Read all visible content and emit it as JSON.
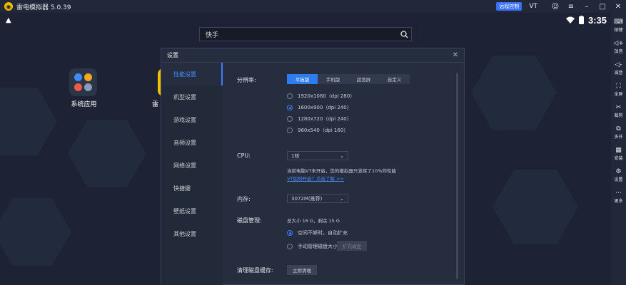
{
  "titlebar": {
    "title": "雷电模拟器 5.0.39",
    "badge": "远程控制",
    "vt": "VT"
  },
  "statusbar": {
    "time": "3:35"
  },
  "desktop": {
    "search_value": "快手",
    "apps": [
      {
        "label": "系统应用"
      },
      {
        "label": "雷"
      }
    ]
  },
  "sidebar": {
    "items": [
      {
        "icon": "keyboard-icon",
        "label": "按键"
      },
      {
        "icon": "volume-up-icon",
        "label": "加音"
      },
      {
        "icon": "volume-down-icon",
        "label": "减音"
      },
      {
        "icon": "fullscreen-icon",
        "label": "全屏"
      },
      {
        "icon": "scissors-icon",
        "label": "裁剪"
      },
      {
        "icon": "multi-window-icon",
        "label": "多开"
      },
      {
        "icon": "install-icon",
        "label": "安装"
      },
      {
        "icon": "gear-icon",
        "label": "设置"
      },
      {
        "icon": "more-icon",
        "label": "更多"
      }
    ]
  },
  "dialog": {
    "title": "设置",
    "nav": [
      "性能设置",
      "机型设置",
      "游戏设置",
      "音频设置",
      "网络设置",
      "快捷键",
      "壁纸设置",
      "其他设置"
    ],
    "resolution": {
      "label": "分辨率:",
      "tabs": [
        "平板版",
        "手机版",
        "超宽屏",
        "自定义"
      ],
      "options": [
        "1920x1080（dpi 280）",
        "1600x900（dpi 240）",
        "1280x720（dpi 240）",
        "960x540（dpi 160）"
      ],
      "selected": 1
    },
    "cpu": {
      "label": "CPU:",
      "value": "1核",
      "note": "当前电脑VT未开启，您的模拟器只发挥了10%的性能",
      "link": "VT如何开启？点击了解 >>"
    },
    "memory": {
      "label": "内存:",
      "value": "3072M(推荐)"
    },
    "disk": {
      "label": "磁盘管理:",
      "info": "总大小 16 G，剩余 15 G",
      "opt1": "空间不够时，自动扩充",
      "opt2": "手动管理磁盘大小",
      "expand_btn": "扩充磁盘"
    },
    "cache": {
      "label": "清理磁盘缓存:",
      "btn": "立即清理"
    }
  }
}
